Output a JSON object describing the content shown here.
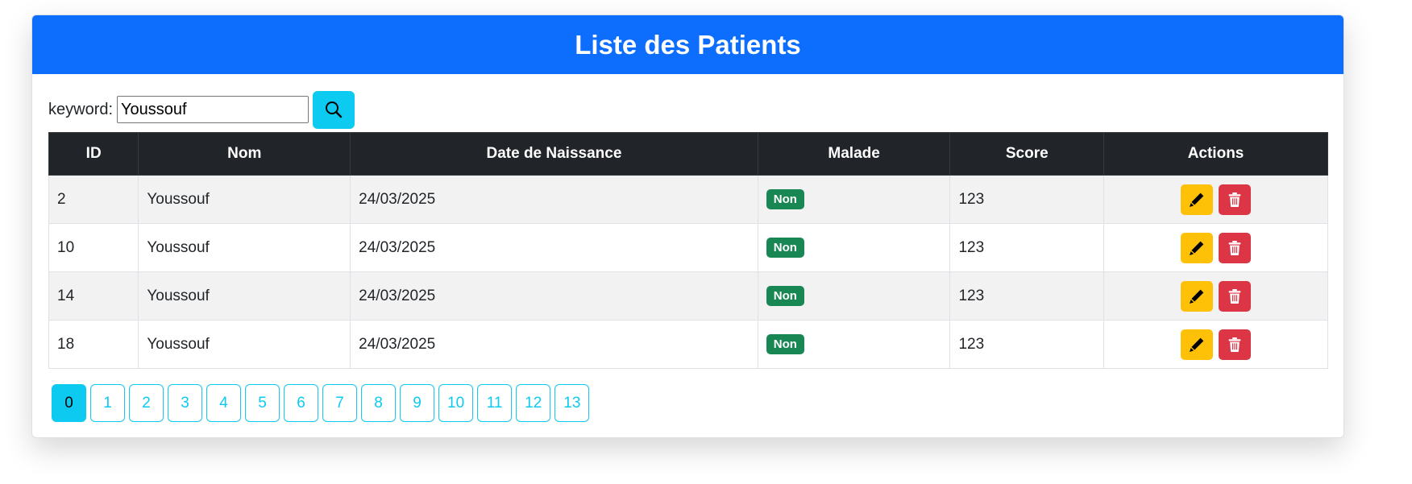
{
  "header": {
    "title": "Liste des Patients"
  },
  "search": {
    "label": "keyword:",
    "value": "Youssouf"
  },
  "table": {
    "columns": [
      "ID",
      "Nom",
      "Date de Naissance",
      "Malade",
      "Score",
      "Actions"
    ],
    "rows": [
      {
        "id": "2",
        "nom": "Youssouf",
        "date": "24/03/2025",
        "malade": "Non",
        "score": "123"
      },
      {
        "id": "10",
        "nom": "Youssouf",
        "date": "24/03/2025",
        "malade": "Non",
        "score": "123"
      },
      {
        "id": "14",
        "nom": "Youssouf",
        "date": "24/03/2025",
        "malade": "Non",
        "score": "123"
      },
      {
        "id": "18",
        "nom": "Youssouf",
        "date": "24/03/2025",
        "malade": "Non",
        "score": "123"
      }
    ]
  },
  "pagination": {
    "pages": [
      "0",
      "1",
      "2",
      "3",
      "4",
      "5",
      "6",
      "7",
      "8",
      "9",
      "10",
      "11",
      "12",
      "13"
    ],
    "current": "0"
  },
  "icons": {
    "search": "search-icon",
    "edit": "pencil-icon",
    "delete": "trash-icon"
  },
  "colors": {
    "primary": "#0d6efd",
    "info": "#0dcaf0",
    "warning": "#ffc107",
    "danger": "#dc3545",
    "success": "#198754",
    "dark": "#212529"
  }
}
